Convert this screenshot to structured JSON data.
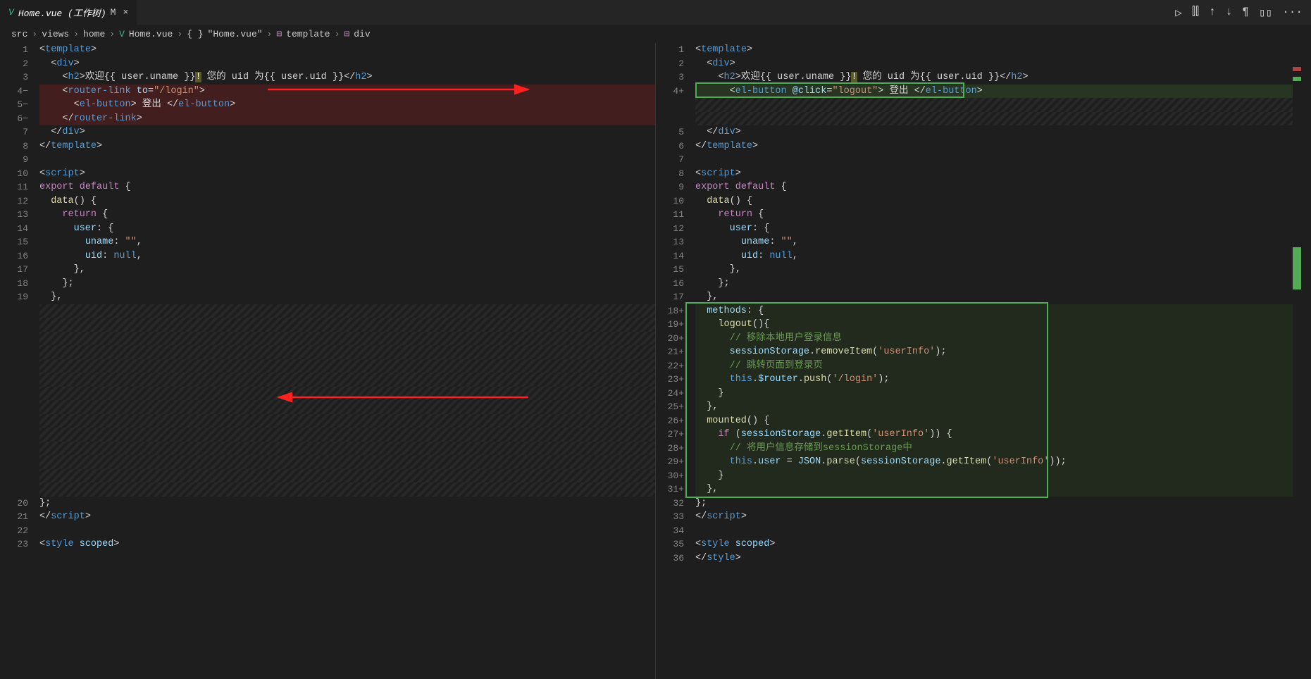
{
  "tab": {
    "icon": "V",
    "title": "Home.vue (工作树)",
    "status": "M",
    "close": "×"
  },
  "tabActions": {
    "run": "▷",
    "split": "⫿⫿",
    "up": "↑",
    "down": "↓",
    "whitespace": "¶",
    "layout": "▯▯",
    "more": "···"
  },
  "breadcrumb": {
    "p1": "src",
    "p2": "views",
    "p3": "home",
    "vueIcon": "V",
    "p4": "Home.vue",
    "braceIcon": "{ }",
    "p5": "\"Home.vue\"",
    "tagIcon1": "⊟",
    "p6": "template",
    "tagIcon2": "⊟",
    "p7": "div",
    "sep": "›"
  },
  "left": {
    "lines": [
      {
        "num": "1",
        "html": "<span class='punct'>&lt;</span><span class='tag'>template</span><span class='punct'>&gt;</span>"
      },
      {
        "num": "2",
        "html": "  <span class='punct'>&lt;</span><span class='tag'>div</span><span class='punct'>&gt;</span>"
      },
      {
        "num": "3",
        "html": "    <span class='punct'>&lt;</span><span class='tag'>h2</span><span class='punct'>&gt;</span><span class='txt'>欢迎{{ user.uname }}</span><span class='white' style='background:#5a5a2a'>!</span><span class='txt'> 您的 uid 为{{ user.uid }}</span><span class='punct'>&lt;/</span><span class='tag'>h2</span><span class='punct'>&gt;</span>"
      },
      {
        "num": "4−",
        "cls": "deleted",
        "html": "    <span class='punct'>&lt;</span><span class='tag'>router-link</span> <span class='attr'>to</span><span class='punct'>=</span><span class='attr-val'>\"/login\"</span><span class='punct'>&gt;</span>"
      },
      {
        "num": "5−",
        "cls": "deleted",
        "html": "      <span class='punct'>&lt;</span><span class='tag'>el-button</span><span class='punct'>&gt;</span><span class='txt'> 登出 </span><span class='punct'>&lt;/</span><span class='tag'>el-button</span><span class='punct'>&gt;</span>"
      },
      {
        "num": "6−",
        "cls": "deleted",
        "html": "    <span class='punct'>&lt;/</span><span class='tag'>router-link</span><span class='punct'>&gt;</span>"
      },
      {
        "num": "7",
        "html": "  <span class='punct'>&lt;/</span><span class='tag'>div</span><span class='punct'>&gt;</span>"
      },
      {
        "num": "8",
        "html": "<span class='punct'>&lt;/</span><span class='tag'>template</span><span class='punct'>&gt;</span>"
      },
      {
        "num": "9",
        "html": ""
      },
      {
        "num": "10",
        "html": "<span class='punct'>&lt;</span><span class='tag'>script</span><span class='punct'>&gt;</span>"
      },
      {
        "num": "11",
        "html": "<span class='keyword2'>export</span> <span class='keyword2'>default</span> <span class='punct'>{</span>"
      },
      {
        "num": "12",
        "html": "  <span class='func'>data</span><span class='punct'>() {</span>"
      },
      {
        "num": "13",
        "html": "    <span class='keyword2'>return</span> <span class='punct'>{</span>"
      },
      {
        "num": "14",
        "html": "      <span class='obj'>user</span><span class='punct'>: {</span>"
      },
      {
        "num": "15",
        "html": "        <span class='obj'>uname</span><span class='punct'>: </span><span class='str'>\"\"</span><span class='punct'>,</span>"
      },
      {
        "num": "16",
        "html": "        <span class='obj'>uid</span><span class='punct'>: </span><span class='keyword'>null</span><span class='punct'>,</span>"
      },
      {
        "num": "17",
        "html": "      <span class='punct'>},</span>"
      },
      {
        "num": "18",
        "html": "    <span class='punct'>};</span>"
      },
      {
        "num": "19",
        "html": "  <span class='punct'>},</span>"
      },
      {
        "num": "",
        "cls": "hatched",
        "html": ""
      },
      {
        "num": "",
        "cls": "hatched",
        "html": ""
      },
      {
        "num": "",
        "cls": "hatched",
        "html": ""
      },
      {
        "num": "",
        "cls": "hatched",
        "html": ""
      },
      {
        "num": "",
        "cls": "hatched",
        "html": ""
      },
      {
        "num": "",
        "cls": "hatched",
        "html": ""
      },
      {
        "num": "",
        "cls": "hatched",
        "html": ""
      },
      {
        "num": "",
        "cls": "hatched",
        "html": ""
      },
      {
        "num": "",
        "cls": "hatched",
        "html": ""
      },
      {
        "num": "",
        "cls": "hatched",
        "html": ""
      },
      {
        "num": "",
        "cls": "hatched",
        "html": ""
      },
      {
        "num": "",
        "cls": "hatched",
        "html": ""
      },
      {
        "num": "",
        "cls": "hatched",
        "html": ""
      },
      {
        "num": "",
        "cls": "hatched",
        "html": ""
      },
      {
        "num": "20",
        "html": "<span class='punct'>};</span>"
      },
      {
        "num": "21",
        "html": "<span class='punct'>&lt;/</span><span class='tag'>script</span><span class='punct'>&gt;</span>"
      },
      {
        "num": "22",
        "html": ""
      },
      {
        "num": "23",
        "html": "<span class='punct'>&lt;</span><span class='tag'>style</span> <span class='attr'>scoped</span><span class='punct'>&gt;</span>"
      }
    ]
  },
  "right": {
    "lines": [
      {
        "num": "1",
        "html": "<span class='punct'>&lt;</span><span class='tag'>template</span><span class='punct'>&gt;</span>"
      },
      {
        "num": "2",
        "html": "  <span class='punct'>&lt;</span><span class='tag'>div</span><span class='punct'>&gt;</span>"
      },
      {
        "num": "3",
        "html": "    <span class='punct'>&lt;</span><span class='tag'>h2</span><span class='punct'>&gt;</span><span class='txt'>欢迎{{ user.uname }}</span><span class='white' style='background:#5a5a2a'>!</span><span class='txt'> 您的 uid 为{{ user.uid }}</span><span class='punct'>&lt;/</span><span class='tag'>h2</span><span class='punct'>&gt;</span>"
      },
      {
        "num": "4+",
        "cls": "added",
        "html": "      <span class='punct'>&lt;</span><span class='tag'>el-button</span> <span class='attr'>@click</span><span class='punct'>=</span><span class='attr-val'>\"logout\"</span><span class='punct'>&gt;</span><span class='txt'> 登出 </span><span class='punct'>&lt;/</span><span class='tag'>el-button</span><span class='punct'>&gt;</span>"
      },
      {
        "num": "",
        "cls": "hatched",
        "html": ""
      },
      {
        "num": "",
        "cls": "hatched",
        "html": ""
      },
      {
        "num": "5",
        "html": "  <span class='punct'>&lt;/</span><span class='tag'>div</span><span class='punct'>&gt;</span>"
      },
      {
        "num": "6",
        "html": "<span class='punct'>&lt;/</span><span class='tag'>template</span><span class='punct'>&gt;</span>"
      },
      {
        "num": "7",
        "html": ""
      },
      {
        "num": "8",
        "html": "<span class='punct'>&lt;</span><span class='tag'>script</span><span class='punct'>&gt;</span>"
      },
      {
        "num": "9",
        "html": "<span class='keyword2'>export</span> <span class='keyword2'>default</span> <span class='punct'>{</span>"
      },
      {
        "num": "10",
        "html": "  <span class='func'>data</span><span class='punct'>() {</span>"
      },
      {
        "num": "11",
        "html": "    <span class='keyword2'>return</span> <span class='punct'>{</span>"
      },
      {
        "num": "12",
        "html": "      <span class='obj'>user</span><span class='punct'>: {</span>"
      },
      {
        "num": "13",
        "html": "        <span class='obj'>uname</span><span class='punct'>: </span><span class='str'>\"\"</span><span class='punct'>,</span>"
      },
      {
        "num": "14",
        "html": "        <span class='obj'>uid</span><span class='punct'>: </span><span class='keyword'>null</span><span class='punct'>,</span>"
      },
      {
        "num": "15",
        "html": "      <span class='punct'>},</span>"
      },
      {
        "num": "16",
        "html": "    <span class='punct'>};</span>"
      },
      {
        "num": "17",
        "html": "  <span class='punct'>},</span>"
      },
      {
        "num": "18+",
        "cls": "added-box",
        "html": "  <span class='obj'>methods</span><span class='punct'>: {</span>"
      },
      {
        "num": "19+",
        "cls": "added-box",
        "html": "    <span class='func'>logout</span><span class='punct'>(){</span>"
      },
      {
        "num": "20+",
        "cls": "added-box",
        "html": "      <span class='comment'>// 移除本地用户登录信息</span>"
      },
      {
        "num": "21+",
        "cls": "added-box",
        "html": "      <span class='obj'>sessionStorage</span><span class='punct'>.</span><span class='func'>removeItem</span><span class='punct'>(</span><span class='str'>'userInfo'</span><span class='punct'>);</span>"
      },
      {
        "num": "22+",
        "cls": "added-box",
        "html": "      <span class='comment'>// 跳转页面到登录页</span>"
      },
      {
        "num": "23+",
        "cls": "added-box",
        "html": "      <span class='keyword'>this</span><span class='punct'>.</span><span class='obj'>$router</span><span class='punct'>.</span><span class='func'>push</span><span class='punct'>(</span><span class='str'>'/login'</span><span class='punct'>);</span>"
      },
      {
        "num": "24+",
        "cls": "added-box",
        "html": "    <span class='punct'>}</span>"
      },
      {
        "num": "25+",
        "cls": "added-box",
        "html": "  <span class='punct'>},</span>"
      },
      {
        "num": "26+",
        "cls": "added-box",
        "html": "  <span class='func'>mounted</span><span class='punct'>() {</span>"
      },
      {
        "num": "27+",
        "cls": "added-box",
        "html": "    <span class='keyword2'>if</span> <span class='punct'>(</span><span class='obj'>sessionStorage</span><span class='punct'>.</span><span class='func'>getItem</span><span class='punct'>(</span><span class='str'>'userInfo'</span><span class='punct'>)) {</span>"
      },
      {
        "num": "28+",
        "cls": "added-box",
        "html": "      <span class='comment'>// 将用户信息存储到sessionStorage中</span>"
      },
      {
        "num": "29+",
        "cls": "added-box",
        "html": "      <span class='keyword'>this</span><span class='punct'>.</span><span class='obj'>user</span> <span class='punct'>=</span> <span class='obj'>JSON</span><span class='punct'>.</span><span class='func'>parse</span><span class='punct'>(</span><span class='obj'>sessionStorage</span><span class='punct'>.</span><span class='func'>getItem</span><span class='punct'>(</span><span class='str'>'userInfo'</span><span class='punct'>));</span>"
      },
      {
        "num": "30+",
        "cls": "added-box",
        "html": "    <span class='punct'>}</span>"
      },
      {
        "num": "31+",
        "cls": "added-box",
        "html": "  <span class='punct'>},</span>"
      },
      {
        "num": "32",
        "html": "<span class='punct'>};</span>"
      },
      {
        "num": "33",
        "html": "<span class='punct'>&lt;/</span><span class='tag'>script</span><span class='punct'>&gt;</span>"
      },
      {
        "num": "34",
        "html": ""
      },
      {
        "num": "35",
        "html": "<span class='punct'>&lt;</span><span class='tag'>style</span> <span class='attr'>scoped</span><span class='punct'>&gt;</span>"
      },
      {
        "num": "36",
        "html": "<span class='punct'>&lt;/</span><span class='tag'>style</span><span class='punct'>&gt;</span>"
      }
    ]
  }
}
